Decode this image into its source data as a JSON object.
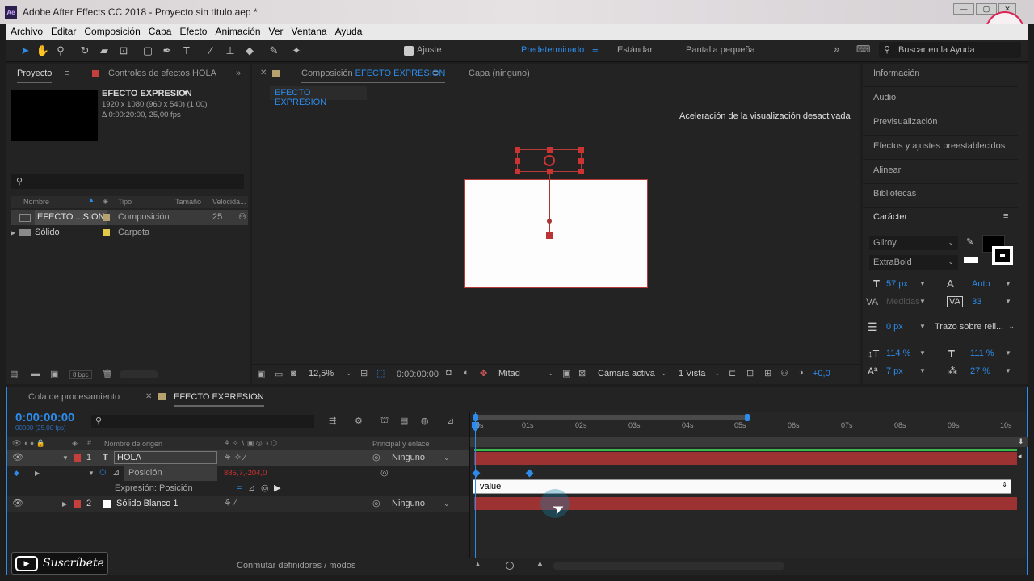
{
  "window": {
    "title": "Adobe After Effects CC 2018 - Proyecto sin título.aep *",
    "app_badge": "Ae"
  },
  "menu": [
    "Archivo",
    "Editar",
    "Composición",
    "Capa",
    "Efecto",
    "Animación",
    "Ver",
    "Ventana",
    "Ayuda"
  ],
  "toolbar": {
    "ajuste_label": "Ajuste",
    "workspaces": [
      "Predeterminado",
      "Estándar",
      "Pantalla pequeña"
    ],
    "search_placeholder": "Buscar en la Ayuda"
  },
  "project_panel": {
    "tab": "Proyecto",
    "tab2": "Controles de efectos HOLA",
    "comp_name": "EFECTO EXPRESION",
    "comp_dims": "1920 x 1080  (960 x 540) (1,00)",
    "comp_dur": "Δ 0:00:20:00, 25,00 fps",
    "search_glyph": "⚲",
    "columns": [
      "Nombre",
      "Tipo",
      "Tamaño",
      "Velocida..."
    ],
    "items": [
      {
        "name": "EFECTO ...SION",
        "type": "Composición",
        "size": "25",
        "color": "#b5a070"
      },
      {
        "name": "Sólido",
        "type": "Carpeta",
        "size": "",
        "color": "#e2c94a"
      }
    ],
    "bpc": "8 bpc"
  },
  "comp_panel": {
    "tab_prefix": "Composición",
    "tab_name": "EFECTO EXPRESION",
    "layer_tab": "Capa (ninguno)",
    "sub_tab": "EFECTO EXPRESION",
    "notice": "Aceleración de la visualización desactivada",
    "zoom": "12,5%",
    "time": "0:00:00:00",
    "resolution": "Mitad",
    "camera": "Cámara activa",
    "views": "1 Vista",
    "exposure": "+0,0"
  },
  "right_panel": {
    "items": [
      "Información",
      "Audio",
      "Previsualización",
      "Efectos y ajustes preestablecidos",
      "Alinear",
      "Bibliotecas"
    ],
    "character_title": "Carácter",
    "font": "Gilroy",
    "style": "ExtraBold",
    "size": "57 px",
    "leading": "Auto",
    "kerning": "Medidas",
    "tracking": "33",
    "stroke": "0 px",
    "stroke_mode": "Trazo sobre rell...",
    "vscale": "114 %",
    "hscale": "111 %",
    "baseline": "7 px",
    "tsume": "27 %"
  },
  "timeline": {
    "tab1": "Cola de procesamiento",
    "tab2": "EFECTO EXPRESION",
    "timecode": "0:00:00:00",
    "timecode_sub": "00000 (25.00 fps)",
    "col_source": "Nombre de origen",
    "col_parent": "Principal y enlace",
    "layers": [
      {
        "num": "1",
        "name": "HOLA",
        "parent": "Ninguno",
        "color": "#c4403c"
      },
      {
        "num": "2",
        "name": "Sólido Blanco 1",
        "parent": "Ninguno",
        "color": "#c4403c"
      }
    ],
    "prop_name": "Posición",
    "prop_value": "885,7,-204,0",
    "expr_label": "Expresión: Posición",
    "expr_text": "value",
    "ticks": [
      "0s",
      "01s",
      "02s",
      "03s",
      "04s",
      "05s",
      "06s",
      "07s",
      "08s",
      "09s",
      "10s"
    ],
    "toggle_label": "Conmutar definidores / modos"
  },
  "overlay": {
    "subscribe": "Suscríbete"
  }
}
